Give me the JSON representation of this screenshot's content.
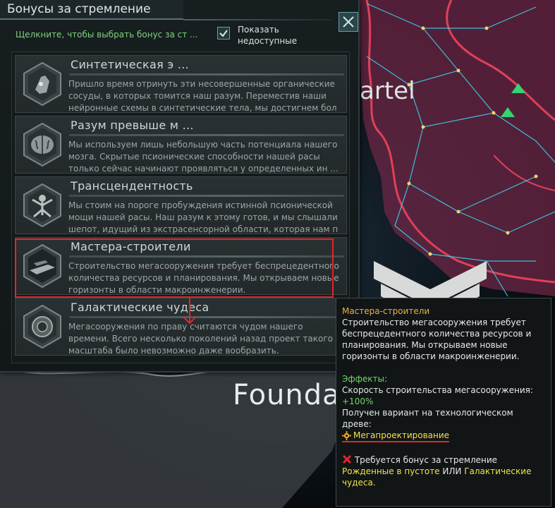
{
  "panel": {
    "title": "Бонусы за стремление",
    "hint": "Щелкните, чтобы выбрать бонус за ст ...",
    "show_unavailable_label": "Показать недоступные",
    "show_unavailable_checked": true
  },
  "items": [
    {
      "title": "Синтетическая э ...",
      "desc": "Пришло время отринуть эти несовершенные органические сосуды, в которых томится наш разум. Переместив наши нейронные схемы в синтетические тела, мы достигнем бол ..."
    },
    {
      "title": "Разум превыше м ...",
      "desc": "Мы используем лишь небольшую часть потенциала нашего мозга. Скрытые псионические способности нашей расы только сейчас начинают проявляться у определенных ин ..."
    },
    {
      "title": "Трансцендентность",
      "desc": "Мы стоим на пороге пробуждения истинной псионической мощи нашей расы. Наш разум к этому готов, и мы слышали шепот, идущий из экстрасенсорной области, которая нам п ..."
    },
    {
      "title": "Мастера-строители",
      "desc": "Строительство мегасооружения требует беспрецедентного количества ресурсов и планирования. Мы открываем новые горизонты в области макроинженерии."
    },
    {
      "title": "Галактические чудеса",
      "desc": "Мегасооружения по праву считаются чудом нашего времени. Всего несколько поколений назад проект такого масштаба было невозможно даже вообразить."
    }
  ],
  "map": {
    "label_cartel": "artel",
    "label_foundation": "Foundation of Wace"
  },
  "tooltip": {
    "title": "Мастера-строители",
    "desc": "Строительство мегасооружения требует беспрецедентного количества ресурсов и планирования. Мы открываем новые горизонты в области макроинженерии.",
    "effects_label": "Эффекты:",
    "effect1": "Скорость строительства мегасооружения:",
    "effect1_value": "+100%",
    "effect2": "Получен вариант на технологическом древе:",
    "tech_name": "Мегапроектирование",
    "req_label": "Требуется бонус за стремление",
    "req_opt1": "Рожденные в пустоте",
    "req_or": "ИЛИ",
    "req_opt2": "Галактические чудеса."
  },
  "colors": {
    "accent_green": "#72d56c",
    "tooltip_title": "#e8b04a",
    "link_yellow": "#f0e24a",
    "highlight_red": "#e0262b",
    "hyperlane": "#3ad0e8",
    "border_red": "#9c2030"
  }
}
